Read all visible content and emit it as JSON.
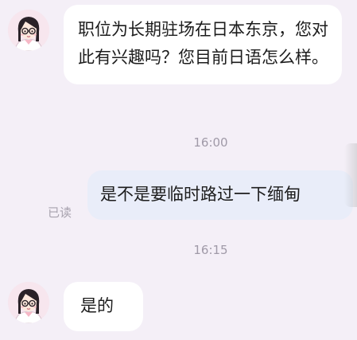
{
  "conversation": {
    "messages": [
      {
        "direction": "incoming",
        "text": "职位为长期驻场在日本东京，您对此有兴趣吗？您目前日语怎么样。"
      },
      {
        "direction": "outgoing",
        "text": "是不是要临时路过一下缅甸",
        "read_status": "已读"
      },
      {
        "direction": "incoming",
        "text": "是的"
      }
    ],
    "timestamps": [
      "16:00",
      "16:15"
    ]
  },
  "avatar": {
    "icon": "girl-with-glasses-avatar-icon"
  },
  "colors": {
    "background": "#f4eff7",
    "incoming_bubble": "#ffffff",
    "outgoing_bubble": "#e9edf9",
    "timestamp_text": "#a09aa8"
  }
}
